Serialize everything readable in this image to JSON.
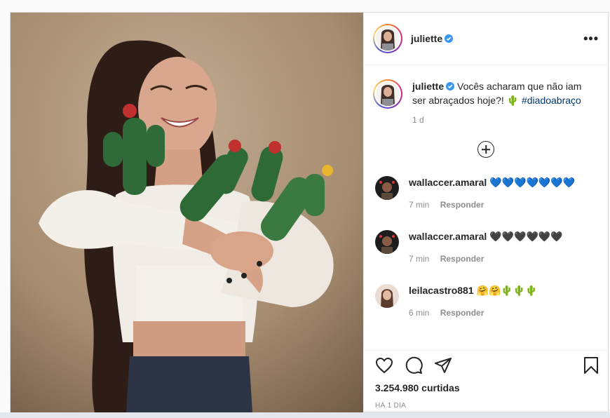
{
  "post": {
    "username": "juliette",
    "verified": true,
    "more_label": "•••",
    "caption": {
      "text": "Vocês acharam que não iam ser abraçados hoje?! 🌵",
      "hashtag": "#diadoabraço",
      "time": "1 d"
    },
    "comments": [
      {
        "username": "wallaccer.amaral",
        "text": "💙💙💙💙💙💙💙",
        "time": "7 min",
        "reply": "Responder"
      },
      {
        "username": "wallaccer.amaral",
        "text": "🖤🖤🖤🖤🖤🖤",
        "time": "7 min",
        "reply": "Responder"
      },
      {
        "username": "leilacastro881",
        "text": "🤗🤗🌵🌵🌵",
        "time": "6 min",
        "reply": "Responder"
      }
    ],
    "shares": "3.254.980 curtidas",
    "date": "HÁ 1 DIA"
  },
  "colors": {
    "verified": "#3897f0",
    "text": "#262626",
    "muted": "#8e8e8e",
    "hashtag": "#00376b"
  },
  "icons": [
    "heart-icon",
    "comment-icon",
    "share-icon",
    "bookmark-icon",
    "add-comment-icon",
    "more-icon"
  ]
}
